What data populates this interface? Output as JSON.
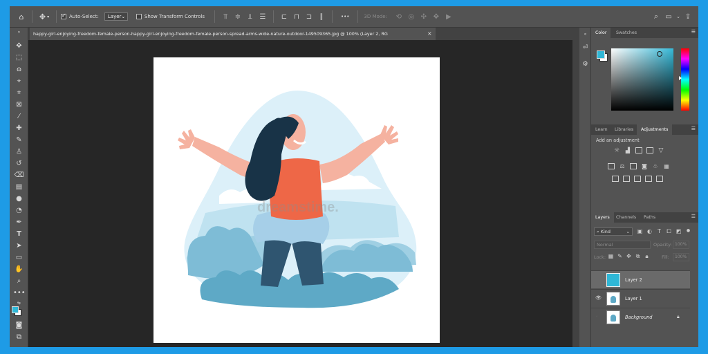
{
  "options_bar": {
    "home_icon": "home-icon",
    "move_icon": "move-tool-icon",
    "auto_select_label": "Auto-Select:",
    "auto_select_checked": true,
    "auto_select_target": "Layer",
    "show_transform_label": "Show Transform Controls",
    "more_label": "•••",
    "mode_3d_label": "3D Mode:"
  },
  "document_tab": {
    "title": "happy-girl-enjoying-freedom-female-person-happy-girl-enjoying-freedom-female-person-spread-arms-wide-nature-outdoor-149509365.jpg @ 100% (Layer 2, RG",
    "close": "×"
  },
  "canvas": {
    "watermark": "dreamstime."
  },
  "color_panel": {
    "tabs": [
      "Color",
      "Swatches"
    ],
    "foreground": "#2fb7d6",
    "background": "#ffffff",
    "hue": "#36b9d8"
  },
  "adjustments_panel": {
    "tabs": [
      "Learn",
      "Libraries",
      "Adjustments"
    ],
    "add_label": "Add an adjustment"
  },
  "layers_panel": {
    "tabs": [
      "Layers",
      "Channels",
      "Paths"
    ],
    "filter_kind": "Kind",
    "blend_mode": "Normal",
    "opacity_label": "Opacity:",
    "opacity_value": "100%",
    "lock_label": "Lock:",
    "fill_label": "Fill:",
    "fill_value": "100%",
    "layers": [
      {
        "name": "Layer 2",
        "visible": false,
        "selected": true
      },
      {
        "name": "Layer 1",
        "visible": true,
        "selected": false
      },
      {
        "name": "Background",
        "visible": false,
        "selected": false
      }
    ]
  }
}
